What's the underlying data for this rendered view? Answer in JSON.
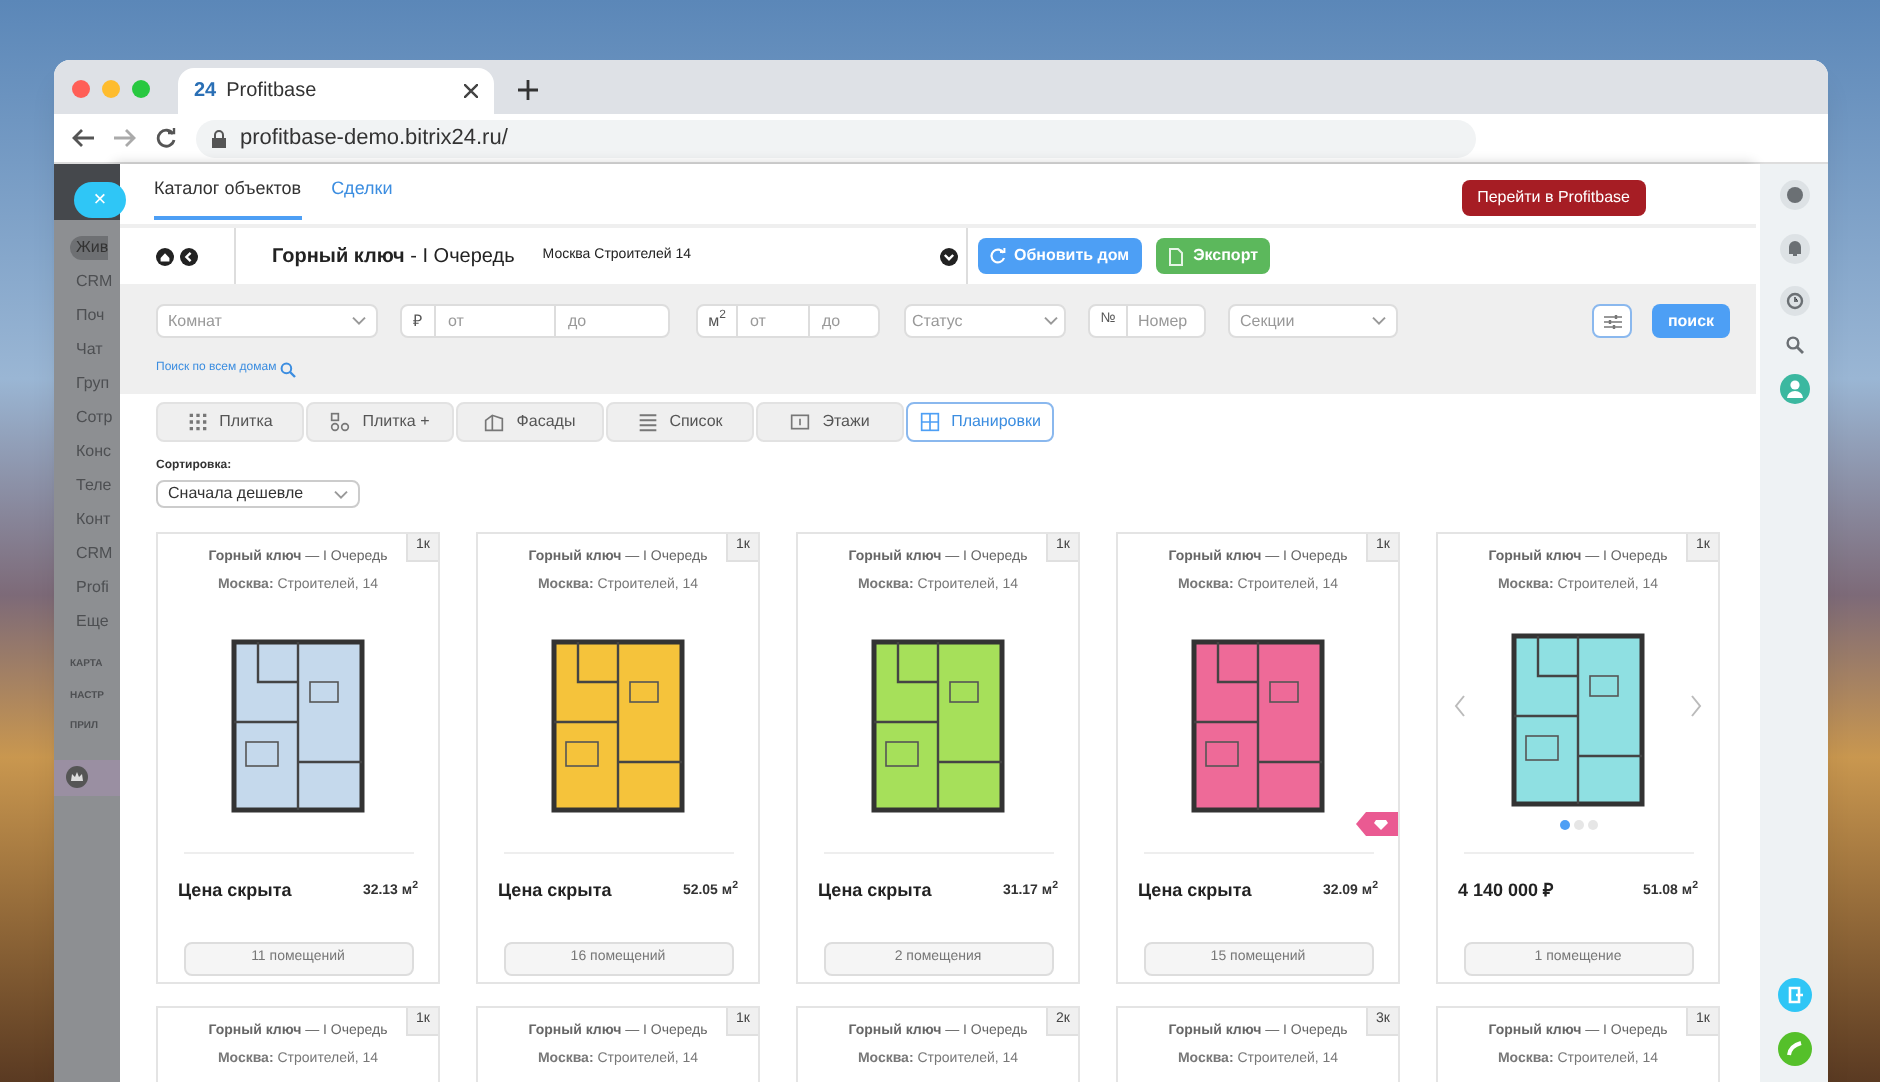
{
  "browser": {
    "tab_title": "Profitbase",
    "tab_logo": "24",
    "url": "profitbase-demo.bitrix24.ru/"
  },
  "bitrix_sidebar": {
    "items": [
      {
        "label": "Жив",
        "selected": true
      },
      {
        "label": "CRM",
        "selected": false
      },
      {
        "label": "Поч",
        "selected": false
      },
      {
        "label": "Чат",
        "selected": false
      },
      {
        "label": "Груп",
        "selected": false
      },
      {
        "label": "Сотр",
        "selected": false
      },
      {
        "label": "Конс",
        "selected": false
      },
      {
        "label": "Теле",
        "selected": false
      },
      {
        "label": "Конт",
        "selected": false
      },
      {
        "label": "CRM",
        "selected": false
      },
      {
        "label": "Profi",
        "selected": false
      },
      {
        "label": "Еще",
        "selected": false
      }
    ],
    "sections": [
      "КАРТА",
      "НАСТР",
      "ПРИЛ"
    ],
    "close_button": "×"
  },
  "panel": {
    "tabs": [
      {
        "label": "Каталог объектов",
        "selected": true
      },
      {
        "label": "Сделки",
        "selected": false
      }
    ],
    "goto_button": "Перейти в Profitbase",
    "house": {
      "title": "**Горный ключ** - I Очередь",
      "address": "Москва Строителей 14",
      "refresh_button": "Обновить дом",
      "export_button": "Экспорт"
    },
    "filters": {
      "rooms": {
        "placeholder": "Комнат"
      },
      "price": {
        "prefix": "₽",
        "from": {
          "placeholder": "от"
        },
        "to": {
          "placeholder": "до"
        }
      },
      "area": {
        "prefix": "м$^{2}$",
        "from": {
          "placeholder": "от"
        },
        "to": {
          "placeholder": "до"
        }
      },
      "status": {
        "placeholder": "Статус"
      },
      "number": {
        "prefix": "№",
        "placeholder": "Номер"
      },
      "sections": {
        "placeholder": "Секции"
      },
      "search_button": "поиск",
      "search_all_link": "Поиск по всем домам"
    },
    "view_tabs": [
      {
        "label": "Плитка",
        "selected": false
      },
      {
        "label": "Плитка +",
        "selected": false
      },
      {
        "label": "Фасады",
        "selected": false
      },
      {
        "label": "Список",
        "selected": false
      },
      {
        "label": "Этажи",
        "selected": false
      },
      {
        "label": "Планировки",
        "selected": true
      }
    ],
    "sort": {
      "label": "Сортировка:",
      "value": "Сначала дешевле"
    },
    "cards": [
      {
        "badge": "1к",
        "title": "**Горный ключ** — I Очередь",
        "address": "**Москва:** Строителей, 14",
        "color": "#c5d9ec",
        "price": "Цена скрыта",
        "area": "32.13 м$^{2}$",
        "rooms_button": "11 помещений",
        "tag": false,
        "carousel": false
      },
      {
        "badge": "1к",
        "title": "**Горный ключ** — I Очередь",
        "address": "**Москва:** Строителей, 14",
        "color": "#f5c33b",
        "price": "Цена скрыта",
        "area": "52.05 м$^{2}$",
        "rooms_button": "16 помещений",
        "tag": false,
        "carousel": false
      },
      {
        "badge": "1к",
        "title": "**Горный ключ** — I Очередь",
        "address": "**Москва:** Строителей, 14",
        "color": "#a6e05a",
        "price": "Цена скрыта",
        "area": "31.17 м$^{2}$",
        "rooms_button": "2 помещения",
        "tag": false,
        "carousel": false
      },
      {
        "badge": "1к",
        "title": "**Горный ключ** — I Очередь",
        "address": "**Москва:** Строителей, 14",
        "color": "#ee6a98",
        "price": "Цена скрыта",
        "area": "32.09 м$^{2}$",
        "rooms_button": "15 помещений",
        "tag": true,
        "carousel": false
      },
      {
        "badge": "1к",
        "title": "**Горный ключ** — I Очередь",
        "address": "**Москва:** Строителей, 14",
        "color": "#8fe0e2",
        "price": "4 140 000 ₽",
        "area": "51.08 м$^{2}$",
        "rooms_button": "1 помещение",
        "tag": false,
        "carousel": true
      }
    ],
    "more_cards": [
      {
        "badge": "1к",
        "title": "**Горный ключ** — I Очередь",
        "address": "**Москва:** Строителей, 14"
      },
      {
        "badge": "1к",
        "title": "**Горный ключ** — I Очередь",
        "address": "**Москва:** Строителей, 14"
      },
      {
        "badge": "2к",
        "title": "**Горный ключ** — I Очередь",
        "address": "**Москва:** Строителей, 14"
      },
      {
        "badge": "3к",
        "title": "**Горный ключ** — I Очередь",
        "address": "**Москва:** Строителей, 14"
      },
      {
        "badge": "1к",
        "title": "**Горный ключ** — I Очередь",
        "address": "**Москва:** Строителей, 14"
      }
    ]
  }
}
